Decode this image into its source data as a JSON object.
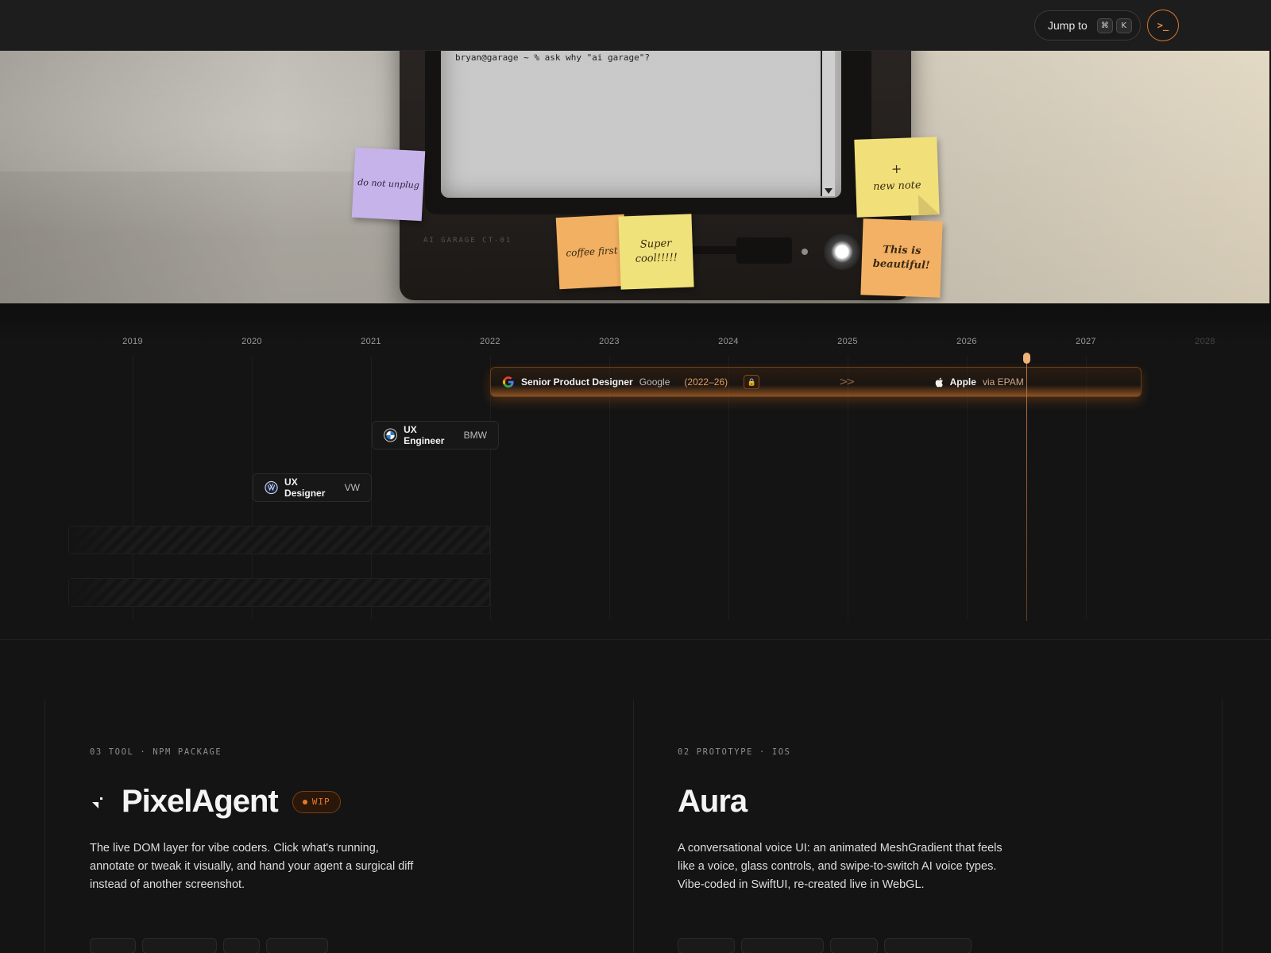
{
  "topbar": {
    "jump_label": "Jump to",
    "shortcut_keys": [
      "⌘",
      "K"
    ],
    "terminal_label": ">_"
  },
  "hero": {
    "terminal_prompt": "bryan@garage ~ % ask why \"ai garage\"?",
    "brand_label": "AI GARAGE CT-01",
    "notes": {
      "purple": "do not unplug",
      "orange_left": "coffee first",
      "yellow_middle": "Super cool!!!!!",
      "new_note_plus": "+",
      "new_note_label": "new note",
      "orange_right": "This is beautiful!"
    }
  },
  "timeline": {
    "years": [
      "2019",
      "2020",
      "2021",
      "2022",
      "2023",
      "2024",
      "2025",
      "2026",
      "2027",
      "2028"
    ],
    "current_job": {
      "role": "Senior Product Designer",
      "company": "Google",
      "dates": "(2022–26)",
      "next_company": "Apple",
      "next_via": "via EPAM"
    },
    "jobs": [
      {
        "role": "UX Engineer",
        "company": "BMW"
      },
      {
        "role": "UX Designer",
        "company": "VW"
      }
    ]
  },
  "projects": [
    {
      "kicker": "03 TOOL · NPM PACKAGE",
      "title": "PixelAgent",
      "badge": "WIP",
      "description": "The live DOM layer for vibe coders. Click what's running, annotate or tweak it visually, and hand your agent a surgical diff instead of another screenshot."
    },
    {
      "kicker": "02 PROTOTYPE · IOS",
      "title": "Aura",
      "description": "A conversational voice UI: an animated MeshGradient that feels like a voice, glass controls, and swipe-to-switch AI voice types. Vibe-coded in SwiftUI, re-created live in WebGL."
    }
  ],
  "colors": {
    "accent": "#e57a2a",
    "background": "#141414",
    "topbar": "#1d1d1d"
  },
  "icons": {
    "terminal": "terminal-icon",
    "google": "google-icon",
    "apple": "apple-icon",
    "bmw": "bmw-logo",
    "vw": "vw-logo",
    "lock": "lock-icon",
    "chevrons": "chevron-double-right-icon",
    "pixelagent": "cursor-icon"
  }
}
